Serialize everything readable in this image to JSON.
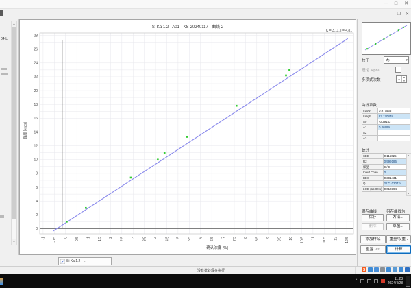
{
  "window": {
    "controls": {
      "minimize": "─",
      "maximize": "□",
      "close": "✕"
    },
    "mdi_controls": {
      "minimize": "_",
      "restore": "❐",
      "close": "✕"
    }
  },
  "sidebar": {
    "item1": "04-L"
  },
  "chart": {
    "title": "Si Ka 1.2 - A01-TKS-20240117 - 曲线 2",
    "readout": "C = 3.11, I = 4.81"
  },
  "chart_data": {
    "type": "scatter",
    "title": "Si Ka 1.2 - A01-TKS-20240117 - 曲线 2",
    "xlabel": "确认浓度 [%]",
    "ylabel": "强度 [kcps]",
    "xlim": [
      -1.15,
      12.8
    ],
    "ylim": [
      -0.75,
      28.35
    ],
    "x_ticks": [
      -1,
      -0.5,
      0,
      0.5,
      1,
      1.5,
      2,
      2.5,
      3,
      3.5,
      4,
      4.5,
      5,
      5.5,
      6,
      6.5,
      7,
      7.5,
      8,
      8.5,
      9,
      9.5,
      10,
      10.5,
      11,
      11.5,
      12,
      12.5
    ],
    "y_ticks": [
      0,
      2,
      4,
      6,
      8,
      10,
      12,
      14,
      16,
      18,
      20,
      22,
      24,
      26,
      28
    ],
    "y_minor_step": 1,
    "annotation": "C = 3.11, I = 4.81",
    "legend": "none",
    "grid": true,
    "points": [
      [
        0.05,
        1.0
      ],
      [
        0.9,
        3.0
      ],
      [
        2.9,
        7.4
      ],
      [
        4.1,
        10.0
      ],
      [
        4.4,
        11.0
      ],
      [
        5.4,
        13.3
      ],
      [
        7.6,
        17.8
      ],
      [
        9.8,
        22.2
      ],
      [
        9.95,
        23.0
      ]
    ],
    "regression_line": {
      "x1": -0.55,
      "y1": -0.34,
      "x2": 12.55,
      "y2": 27.53
    },
    "marker_line_x": -0.15,
    "marker_line_ytop": 27.3,
    "colors": {
      "line": "#8b8bec",
      "point": "#33cc33",
      "grid": "#e7e7ec",
      "axis": "#6f6f6f",
      "marker": "#4a4a4a",
      "border": "#c6c6c6"
    }
  },
  "panel": {
    "calibration_label": "校正",
    "calibration_value": "无",
    "alpha_label": "理论 Alpha",
    "poly_label": "多项式次数",
    "poly_value": "1",
    "coeff": {
      "title": "曲线系数",
      "rows": [
        {
          "k": "I Low",
          "v": "0.977535",
          "hl": false
        },
        {
          "k": "I High",
          "v": "27.170848",
          "hl": true
        },
        {
          "k": "A0",
          "v": "-0.39143",
          "hl": false
        },
        {
          "k": "A1",
          "v": "0.46999",
          "hl": true
        },
        {
          "k": "A2",
          "v": "",
          "hl": false
        },
        {
          "k": "A3",
          "v": "",
          "hl": false
        }
      ]
    },
    "stats": {
      "title": "统计",
      "rows": [
        {
          "k": "SEE",
          "v": "0.116025",
          "hl": false
        },
        {
          "k": "R2",
          "v": "0.999186",
          "hl": true
        },
        {
          "k": "样品",
          "v": "9 / 9",
          "hl": false
        },
        {
          "k": "Interf Chan",
          "v": "0",
          "hl": true
        },
        {
          "k": "BEC",
          "v": "0.391431",
          "hl": false
        },
        {
          "k": "Q",
          "v": "2173.020424",
          "hl": true
        },
        {
          "k": "LOD (15.00 s)",
          "v": "0.010394",
          "hl": false
        }
      ]
    },
    "save_group": "保存曲线:",
    "saveas_group": "另存曲线为:",
    "btn_save": "保存",
    "btn_delete": "删除",
    "btn_method": "方法...",
    "btn_sketch": "草图...",
    "btn_add_sample": "添加样品",
    "btn_weight": "重量/权重",
    "btn_reset": "重置",
    "btn_reset_hint": "M/R",
    "btn_calc": "计算"
  },
  "tabbar": {
    "tab": "Si Ka 1.2 - ..."
  },
  "statusbar": {
    "message": "没有批处理在执行"
  },
  "tray": {
    "icons": [
      {
        "name": "sogou-icon",
        "glyph": "S",
        "bg": "#f75c1e"
      },
      {
        "name": "tray-globe-icon",
        "glyph": "",
        "bg": "#3f8cd6"
      },
      {
        "name": "tray-pen-icon",
        "glyph": "",
        "bg": "#4a90d9"
      },
      {
        "name": "tray-emoji-icon",
        "glyph": "",
        "bg": "#8a9096"
      },
      {
        "name": "tray-mic-icon",
        "glyph": "",
        "bg": "#3f8cd6"
      },
      {
        "name": "tray-keyboard-icon",
        "glyph": "",
        "bg": "#5b9bd5"
      },
      {
        "name": "tray-upload-icon",
        "glyph": "",
        "bg": "#3f8cd6"
      },
      {
        "name": "tray-tool-icon",
        "glyph": "",
        "bg": "#2f6fc1"
      }
    ]
  },
  "taskbar": {
    "expand": "^",
    "time": "11:28",
    "date": "2024/4/28"
  }
}
